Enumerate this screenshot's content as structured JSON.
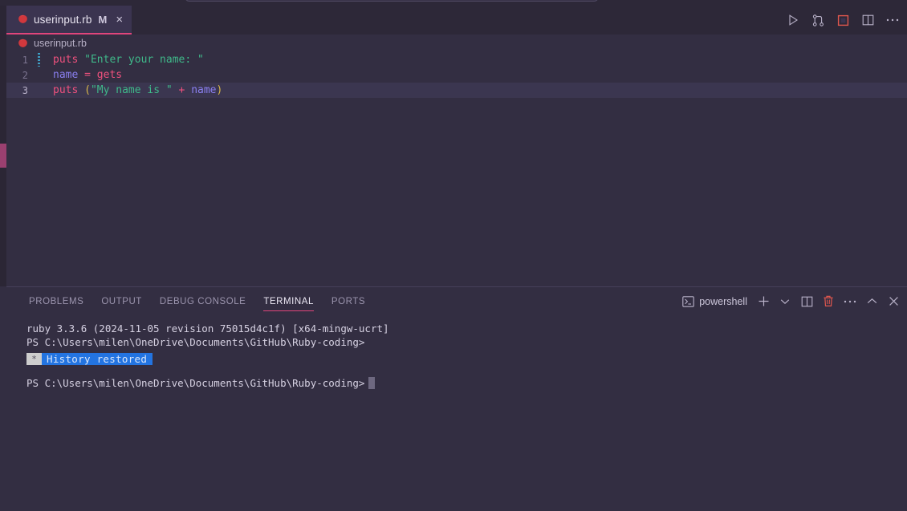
{
  "window": {
    "background_color": "#332e42",
    "accent_color": "#e0457b"
  },
  "tabs": [
    {
      "filename": "userinput.rb",
      "dirty_badge": "M",
      "close_label": "×",
      "icon": "ruby-gem-icon",
      "active": true
    }
  ],
  "editor_actions": [
    {
      "name": "run-button",
      "icon": "play-icon",
      "title": "Run"
    },
    {
      "name": "run-and-debug-button",
      "icon": "fork-icon",
      "title": "Run or Debug"
    },
    {
      "name": "stop-button",
      "icon": "stop-square-icon",
      "title": "Stop",
      "color": "#e0574e"
    },
    {
      "name": "split-editor-button",
      "icon": "split-editor-icon",
      "title": "Split Editor"
    },
    {
      "name": "more-actions-button",
      "icon": "ellipsis-icon",
      "title": "More Actions..."
    }
  ],
  "breadcrumb": {
    "icon": "ruby-gem-icon",
    "label": "userinput.rb"
  },
  "code": {
    "language": "ruby",
    "lines": [
      {
        "number": "1",
        "active": false,
        "change_marker": true,
        "tokens": [
          {
            "text": "puts ",
            "type": "keyword"
          },
          {
            "text": "\"Enter your name: \"",
            "type": "string"
          }
        ]
      },
      {
        "number": "2",
        "active": false,
        "change_marker": false,
        "tokens": [
          {
            "text": "name ",
            "type": "variable"
          },
          {
            "text": "= ",
            "type": "operator"
          },
          {
            "text": "gets",
            "type": "keyword"
          }
        ]
      },
      {
        "number": "3",
        "active": true,
        "change_marker": false,
        "tokens": [
          {
            "text": "puts ",
            "type": "keyword"
          },
          {
            "text": "(",
            "type": "paren"
          },
          {
            "text": "\"My name is \"",
            "type": "string"
          },
          {
            "text": " + ",
            "type": "operator"
          },
          {
            "text": "name",
            "type": "variable"
          },
          {
            "text": ")",
            "type": "paren"
          }
        ]
      }
    ]
  },
  "panel": {
    "tabs": [
      {
        "label": "PROBLEMS",
        "active": false
      },
      {
        "label": "OUTPUT",
        "active": false
      },
      {
        "label": "DEBUG CONSOLE",
        "active": false
      },
      {
        "label": "TERMINAL",
        "active": true
      },
      {
        "label": "PORTS",
        "active": false
      }
    ],
    "shell": {
      "icon": "terminal-icon",
      "name": "powershell"
    },
    "actions": [
      {
        "name": "new-terminal-button",
        "icon": "plus-icon",
        "title": "New Terminal"
      },
      {
        "name": "terminal-profile-dropdown",
        "icon": "chevron-down-icon",
        "title": "Launch Profile..."
      },
      {
        "name": "split-terminal-button",
        "icon": "split-icon",
        "title": "Split Terminal"
      },
      {
        "name": "kill-terminal-button",
        "icon": "trash-icon",
        "title": "Kill Terminal",
        "color": "#e0574e"
      },
      {
        "name": "panel-more-actions-button",
        "icon": "ellipsis-icon",
        "title": "Views and More Actions..."
      },
      {
        "name": "maximize-panel-button",
        "icon": "chevron-up-icon",
        "title": "Maximize Panel Size"
      },
      {
        "name": "close-panel-button",
        "icon": "close-icon",
        "title": "Close Panel"
      }
    ]
  },
  "terminal": {
    "lines": [
      {
        "type": "text",
        "text": "ruby 3.3.6 (2024-11-05 revision 75015d4c1f) [x64-mingw-ucrt]"
      },
      {
        "type": "text",
        "text": "PS C:\\Users\\milen\\OneDrive\\Documents\\GitHub\\Ruby-coding>"
      },
      {
        "type": "history",
        "star": "*",
        "message": "History restored"
      },
      {
        "type": "blank",
        "text": ""
      },
      {
        "type": "prompt",
        "text": "PS C:\\Users\\milen\\OneDrive\\Documents\\GitHub\\Ruby-coding>"
      }
    ]
  }
}
